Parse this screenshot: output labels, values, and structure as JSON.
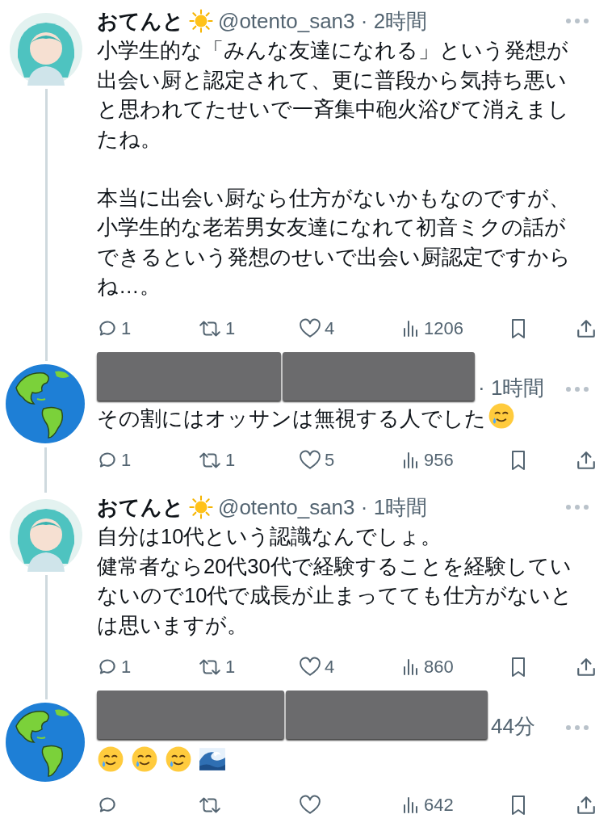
{
  "tweets": [
    {
      "kind": "named",
      "avatar": {
        "kind": "character"
      },
      "name": "おてんと",
      "name_emoji": {
        "kind": "sun"
      },
      "meta": "@otento_san3 · 2時間",
      "paragraphs": [
        "小学生的な「みんな友達になれる」という発想が出会い厨と認定されて、更に普段から気持ち悪いと思われてたせいで一斉集中砲火浴びて消えましたね。",
        "本当に出会い厨なら仕方がないかもなのですが、小学生的な老若男女友達になれて初音ミクの話ができるという発想のせいで出会い厨認定ですからね…。"
      ],
      "blank_line_between": true,
      "stats": {
        "replies": "1",
        "retweets": "1",
        "likes": "4",
        "views": "1206"
      },
      "connected_below": true
    },
    {
      "kind": "redacted",
      "avatar": {
        "kind": "globe"
      },
      "meta": "· 1時間",
      "paragraphs": [
        "その割にはオッサンは無視する人でした"
      ],
      "emojis": [
        {
          "kind": "smile_tear"
        }
      ],
      "stats": {
        "replies": "1",
        "retweets": "1",
        "likes": "5",
        "views": "956"
      },
      "connected_below": true
    },
    {
      "kind": "named",
      "avatar": {
        "kind": "character"
      },
      "name": "おてんと",
      "name_emoji": {
        "kind": "sun"
      },
      "meta": "@otento_san3 · 1時間",
      "paragraphs": [
        "自分は10代という認識なんでしょ。",
        "健常者なら20代30代で経験することを経験していないので10代で成長が止まってても仕方がないとは思いますが。"
      ],
      "blank_line_between": false,
      "stats": {
        "replies": "1",
        "retweets": "1",
        "likes": "4",
        "views": "860"
      },
      "connected_below": true
    },
    {
      "kind": "redacted",
      "avatar": {
        "kind": "globe"
      },
      "meta": "44分",
      "emojis": [
        {
          "kind": "smile_tear"
        },
        {
          "kind": "smile_tear"
        },
        {
          "kind": "smile_tear"
        },
        {
          "kind": "wave"
        }
      ],
      "stats": {
        "views": "642"
      }
    }
  ]
}
